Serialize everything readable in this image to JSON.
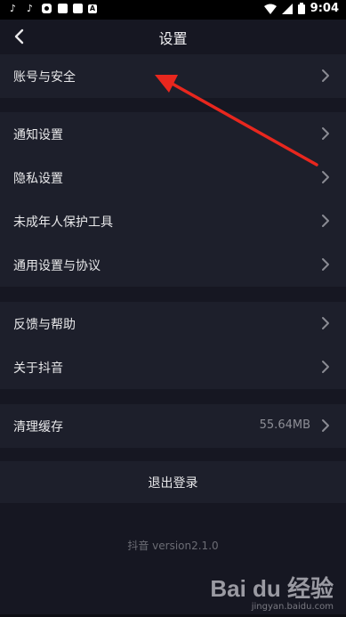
{
  "statusbar": {
    "left_icons": [
      "tiktok-icon",
      "tiktok-icon",
      "app-icon",
      "square-icon",
      "square-icon",
      "a-icon"
    ],
    "time": "9:04"
  },
  "header": {
    "title": "设置"
  },
  "groups": {
    "account": {
      "items": [
        {
          "label": "账号与安全"
        }
      ]
    },
    "settings": {
      "items": [
        {
          "label": "通知设置"
        },
        {
          "label": "隐私设置"
        },
        {
          "label": "未成年人保护工具"
        },
        {
          "label": "通用设置与协议"
        }
      ]
    },
    "help": {
      "items": [
        {
          "label": "反馈与帮助"
        },
        {
          "label": "关于抖音"
        }
      ]
    },
    "cache": {
      "label": "清理缓存",
      "value": "55.64MB"
    }
  },
  "logout": {
    "label": "退出登录"
  },
  "footer": {
    "version": "抖音 version2.1.0"
  },
  "watermark": {
    "logo_text": "Bai du 经验",
    "url": "jingyan.baidu.com"
  },
  "colors": {
    "background": "#161722",
    "group_bg": "#1d1f2b",
    "arrow": "#e8271e"
  }
}
